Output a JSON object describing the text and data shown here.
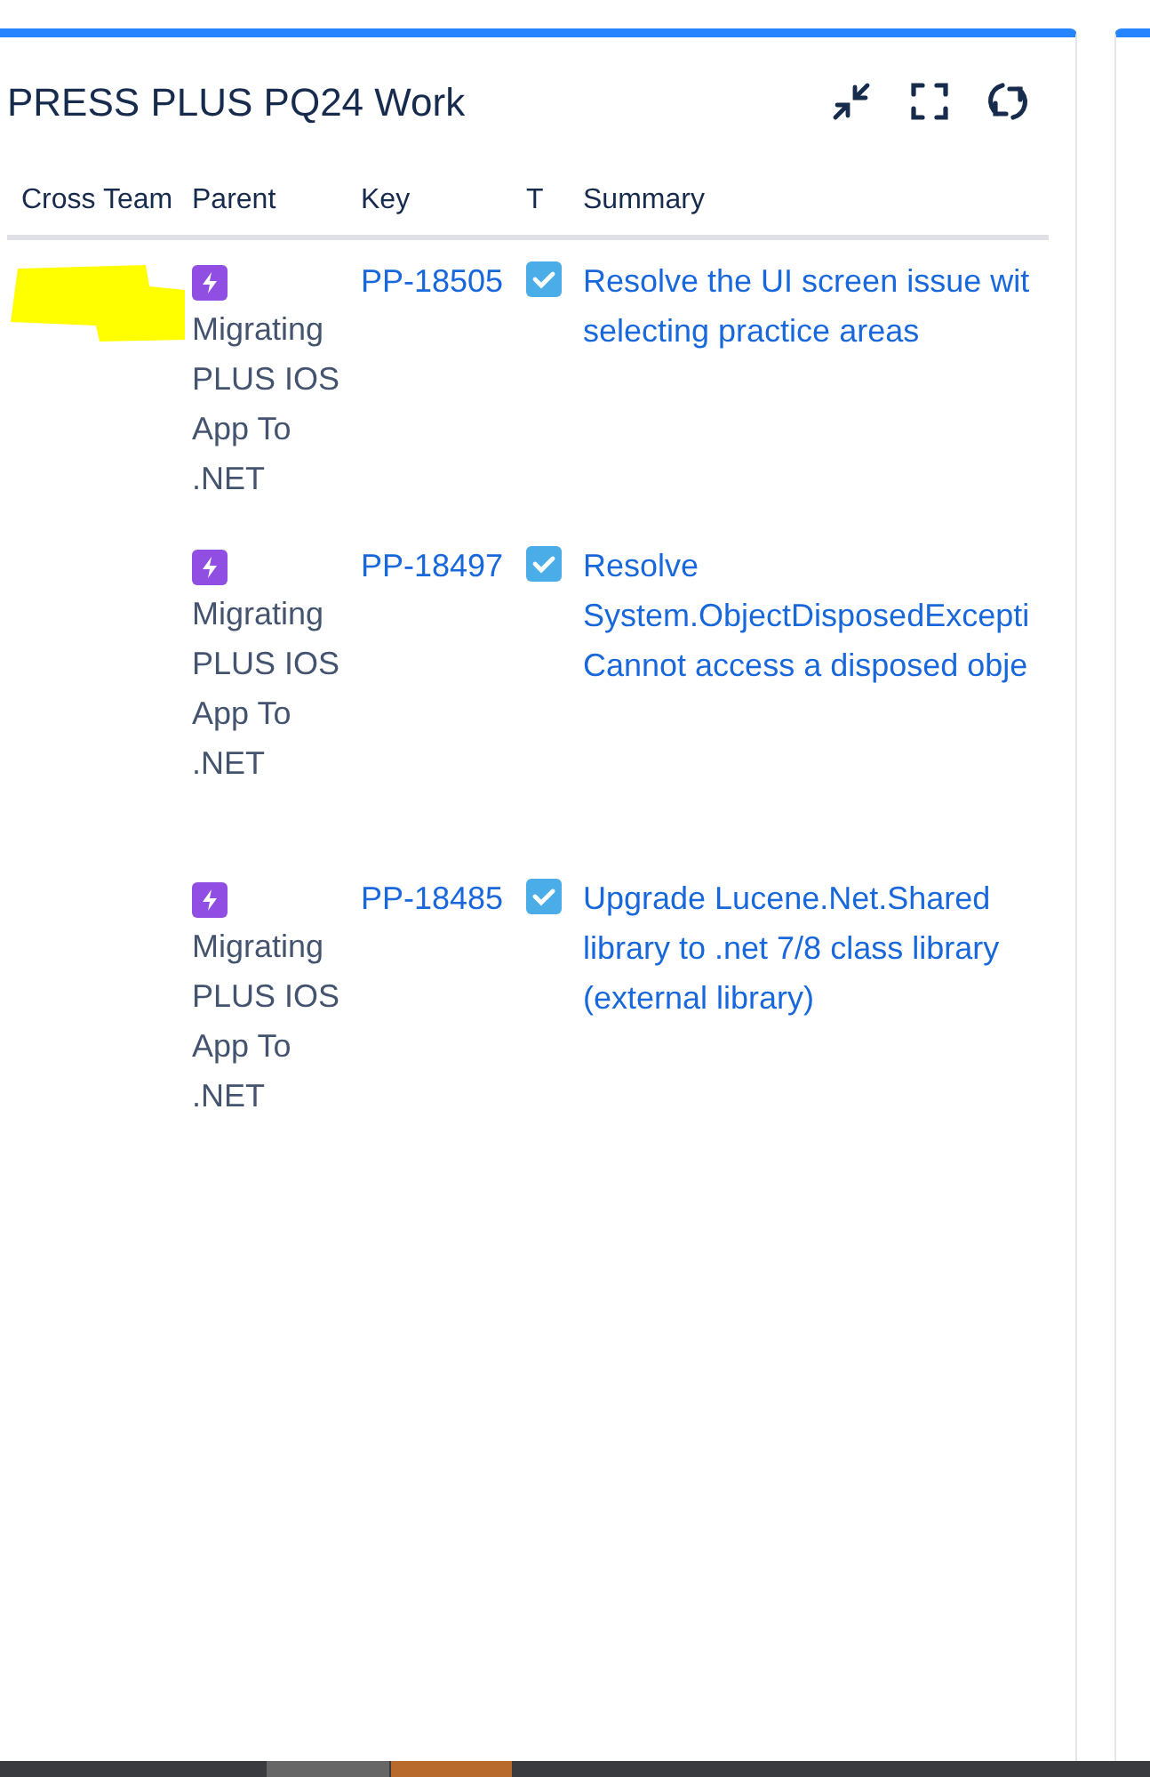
{
  "panel": {
    "title": "PRESS PLUS PQ24 Work"
  },
  "table": {
    "columns": [
      "Cross Team",
      "Parent",
      "Key",
      "T",
      "Summary"
    ],
    "rows": [
      {
        "cross_team_redacted": true,
        "parent": "Migrating PLUS IOS App To .NET",
        "key": "PP-18505",
        "type_checked": true,
        "summary_lines": [
          "Resolve the UI screen issue wit",
          "selecting practice areas"
        ]
      },
      {
        "cross_team_redacted": false,
        "parent": "Migrating PLUS IOS App To .NET",
        "key": "PP-18497",
        "type_checked": true,
        "summary_lines": [
          "Resolve",
          "System.ObjectDisposedExcepti",
          "Cannot access a disposed obje"
        ]
      },
      {
        "cross_team_redacted": false,
        "parent": "Migrating PLUS IOS App To .NET",
        "key": "PP-18485",
        "type_checked": true,
        "summary_lines": [
          "Upgrade Lucene.Net.Shared",
          "library to .net 7/8 class library",
          "(external library)"
        ]
      }
    ]
  }
}
